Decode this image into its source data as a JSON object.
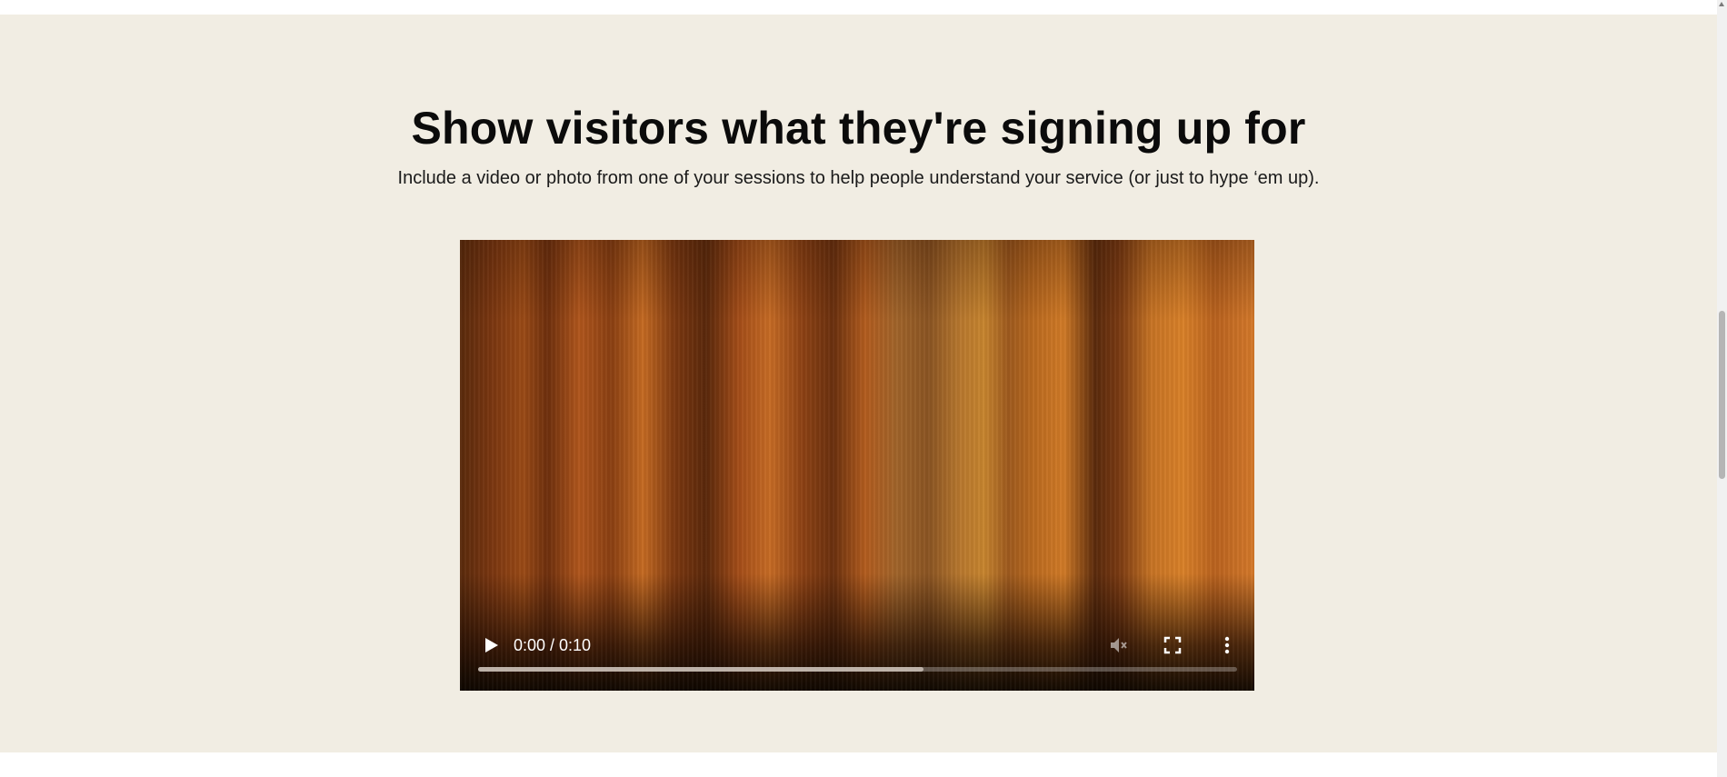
{
  "section": {
    "headline": "Show visitors what they're signing up for",
    "subheadline": "Include a video or photo from one of your sessions to help people understand your service (or just to hype ‘em up)."
  },
  "video": {
    "time_display": "0:00 / 0:10",
    "current_time": "0:00",
    "duration": "0:10",
    "progress_fraction": 0.587,
    "icons": {
      "play": "play-icon",
      "mute": "volume-muted-icon",
      "fullscreen": "fullscreen-icon",
      "more": "more-vertical-icon"
    }
  },
  "colors": {
    "section_bg": "#f1ede3",
    "text": "#0b0b0b",
    "video_tone": "#b8681e"
  }
}
